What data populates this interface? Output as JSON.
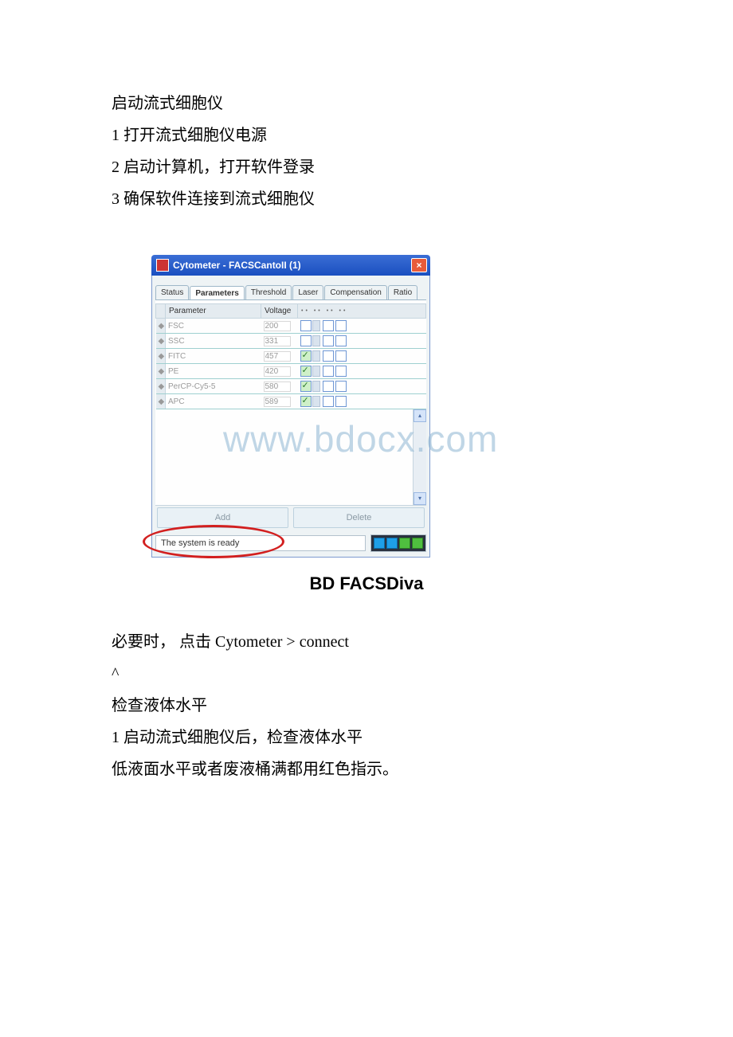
{
  "doc": {
    "lines_a": [
      "启动流式细胞仪",
      "1 打开流式细胞仪电源",
      "2 启动计算机，打开软件登录",
      "3 确保软件连接到流式细胞仪"
    ],
    "lines_b": [
      "必要时， 点击 Cytometer > connect",
      "^",
      "检查液体水平",
      "1 启动流式细胞仪后，检查液体水平",
      "低液面水平或者废液桶满都用红色指示。"
    ]
  },
  "window": {
    "title": "Cytometer - FACSCantoII (1)",
    "close_glyph": "×",
    "tabs": [
      "Status",
      "Parameters",
      "Threshold",
      "Laser",
      "Compensation",
      "Ratio"
    ],
    "active_tab": 1,
    "columns": [
      "Parameter",
      "Voltage"
    ],
    "rows": [
      {
        "name": "FSC",
        "voltage": "200",
        "log": false
      },
      {
        "name": "SSC",
        "voltage": "331",
        "log": false
      },
      {
        "name": "FITC",
        "voltage": "457",
        "log": true
      },
      {
        "name": "PE",
        "voltage": "420",
        "log": true
      },
      {
        "name": "PerCP-Cy5-5",
        "voltage": "580",
        "log": true
      },
      {
        "name": "APC",
        "voltage": "589",
        "log": true
      }
    ],
    "buttons": {
      "add": "Add",
      "del": "Delete"
    },
    "status": "The system is ready",
    "leds": [
      "blue",
      "blue",
      "green",
      "green"
    ]
  },
  "caption": "BD FACSDiva",
  "watermark": "www.bdocx.com"
}
